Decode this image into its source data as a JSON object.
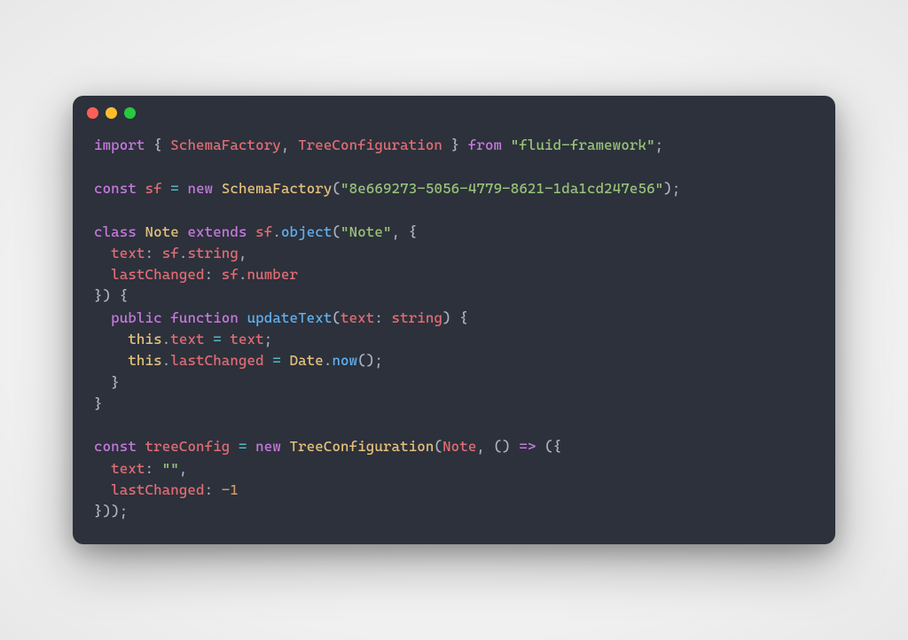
{
  "titlebar": {
    "dot_red": "close",
    "dot_yellow": "minimize",
    "dot_green": "maximize"
  },
  "code": {
    "line1": {
      "kw1": "import",
      "imp1": "SchemaFactory",
      "imp2": "TreeConfiguration",
      "kw2": "from",
      "pkg": "\"fluid-framework\""
    },
    "line2": {
      "kw": "const",
      "var": "sf",
      "op": "=",
      "newkw": "new",
      "cls": "SchemaFactory",
      "arg": "\"8e669273-5056-4779-8621-1da1cd247e56\""
    },
    "line3": {
      "kw1": "class",
      "name": "Note",
      "kw2": "extends",
      "obj": "sf",
      "method": "object",
      "arg1": "\"Note\""
    },
    "line4": {
      "key": "text",
      "obj": "sf",
      "prop": "string"
    },
    "line5": {
      "key": "lastChanged",
      "obj": "sf",
      "prop": "number"
    },
    "line6": {
      "kw1": "public",
      "kw2": "function",
      "fn": "updateText",
      "param": "text",
      "type": "string"
    },
    "line7": {
      "this": "this",
      "prop": "text",
      "op": "=",
      "val": "text"
    },
    "line8": {
      "this": "this",
      "prop": "lastChanged",
      "op": "=",
      "cls": "Date",
      "fn": "now"
    },
    "line9": {
      "kw": "const",
      "var": "treeConfig",
      "op": "=",
      "newkw": "new",
      "cls": "TreeConfiguration",
      "arg1": "Note"
    },
    "line10": {
      "key": "text",
      "val": "\"\""
    },
    "line11": {
      "key": "lastChanged",
      "val": "-1"
    }
  }
}
